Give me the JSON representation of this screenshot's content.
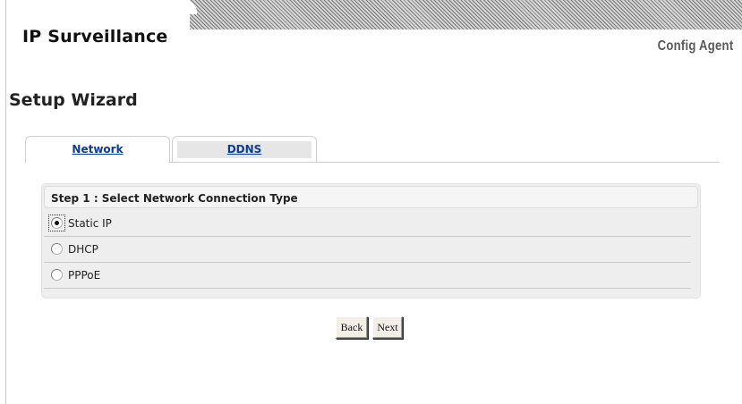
{
  "header": {
    "app_title": "IP Surveillance",
    "product_name": "Config Agent"
  },
  "page": {
    "heading": "Setup Wizard"
  },
  "tabs": [
    {
      "label": "Network",
      "active": true
    },
    {
      "label": "DDNS",
      "active": false
    }
  ],
  "panel": {
    "title": "Step 1 : Select Network Connection Type",
    "options": [
      {
        "label": "Static IP",
        "checked": true
      },
      {
        "label": "DHCP",
        "checked": false
      },
      {
        "label": "PPPoE",
        "checked": false
      }
    ]
  },
  "actions": {
    "back_label": "Back",
    "next_label": "Next"
  },
  "colors": {
    "link": "#0b3d91",
    "panel_background": "#eeeeee",
    "header_stripe": "#8a8a8a"
  }
}
